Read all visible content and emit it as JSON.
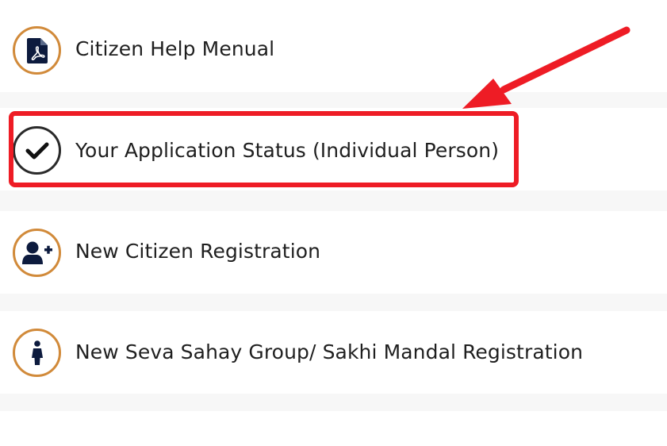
{
  "menu": {
    "items": [
      {
        "label": "Citizen Help Menual",
        "icon": "pdf-document-icon"
      },
      {
        "label": "Your Application Status (Individual Person)",
        "icon": "checkmark-icon"
      },
      {
        "label": "New Citizen Registration",
        "icon": "add-user-icon"
      },
      {
        "label": "New Seva Sahay Group/ Sakhi Mandal Registration",
        "icon": "person-icon"
      }
    ]
  },
  "colors": {
    "icon_ring": "#d18a3a",
    "icon_fill": "#0d1b3e",
    "highlight": "#ee1c25",
    "text": "#1f1f1f"
  }
}
